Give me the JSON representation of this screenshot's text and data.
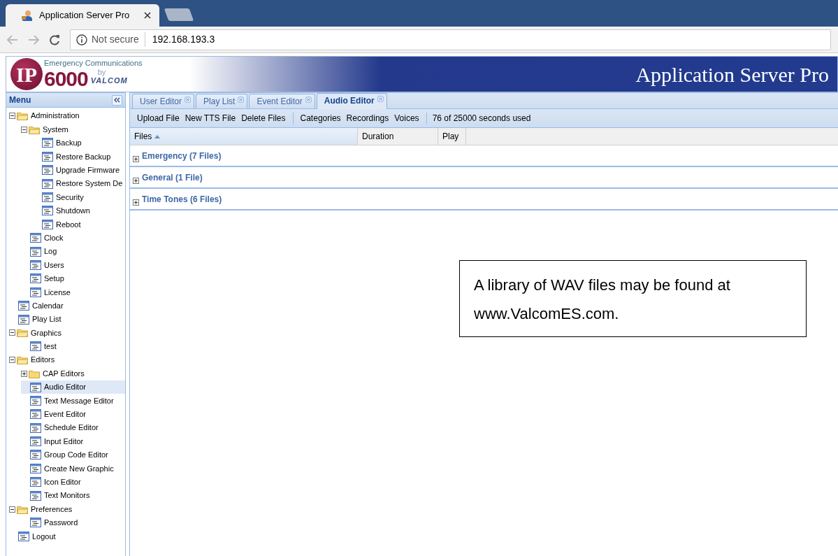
{
  "browser": {
    "tab_title": "Application Server Pro",
    "security": "Not secure",
    "url": "192.168.193.3"
  },
  "header": {
    "logo_letters": "IP",
    "logo_number": "6000",
    "logo_tagline": "Emergency Communications",
    "logo_by": "by",
    "logo_brand": "VALCOM",
    "title": "Application Server Pro"
  },
  "menu": {
    "title": "Menu",
    "tree": [
      {
        "label": "Administration",
        "kind": "folder",
        "expanded": true,
        "selected": false,
        "children": [
          {
            "label": "System",
            "kind": "folder",
            "expanded": true,
            "selected": false,
            "children": [
              {
                "label": "Backup",
                "kind": "page",
                "selected": false
              },
              {
                "label": "Restore Backup",
                "kind": "page",
                "selected": false
              },
              {
                "label": "Upgrade Firmware",
                "kind": "page",
                "selected": false
              },
              {
                "label": "Restore System De",
                "kind": "page",
                "selected": false
              },
              {
                "label": "Security",
                "kind": "page",
                "selected": false
              },
              {
                "label": "Shutdown",
                "kind": "page",
                "selected": false
              },
              {
                "label": "Reboot",
                "kind": "page",
                "selected": false
              }
            ]
          },
          {
            "label": "Clock",
            "kind": "page",
            "selected": false
          },
          {
            "label": "Log",
            "kind": "page",
            "selected": false
          },
          {
            "label": "Users",
            "kind": "page",
            "selected": false
          },
          {
            "label": "Setup",
            "kind": "page",
            "selected": false
          },
          {
            "label": "License",
            "kind": "page",
            "selected": false
          }
        ]
      },
      {
        "label": "Calendar",
        "kind": "page",
        "selected": false
      },
      {
        "label": "Play List",
        "kind": "page",
        "selected": false
      },
      {
        "label": "Graphics",
        "kind": "folder",
        "expanded": true,
        "selected": false,
        "children": [
          {
            "label": "test",
            "kind": "page",
            "selected": false
          }
        ]
      },
      {
        "label": "Editors",
        "kind": "folder",
        "expanded": true,
        "selected": false,
        "children": [
          {
            "label": "CAP Editors",
            "kind": "folder",
            "expanded": false,
            "selected": false
          },
          {
            "label": "Audio Editor",
            "kind": "page",
            "selected": true
          },
          {
            "label": "Text Message Editor",
            "kind": "page",
            "selected": false
          },
          {
            "label": "Event Editor",
            "kind": "page",
            "selected": false
          },
          {
            "label": "Schedule Editor",
            "kind": "page",
            "selected": false
          },
          {
            "label": "Input Editor",
            "kind": "page",
            "selected": false
          },
          {
            "label": "Group Code Editor",
            "kind": "page",
            "selected": false
          },
          {
            "label": "Create New Graphic",
            "kind": "page",
            "selected": false
          },
          {
            "label": "Icon Editor",
            "kind": "page",
            "selected": false
          },
          {
            "label": "Text Monitors",
            "kind": "page",
            "selected": false
          }
        ]
      },
      {
        "label": "Preferences",
        "kind": "folder",
        "expanded": true,
        "selected": false,
        "children": [
          {
            "label": "Password",
            "kind": "page",
            "selected": false
          }
        ]
      },
      {
        "label": "Logout",
        "kind": "page",
        "selected": false
      }
    ]
  },
  "tabs": [
    {
      "label": "User Editor",
      "selected": false
    },
    {
      "label": "Play List",
      "selected": false
    },
    {
      "label": "Event Editor",
      "selected": false
    },
    {
      "label": "Audio Editor",
      "selected": true
    }
  ],
  "toolbar": {
    "groups": [
      [
        "Upload File",
        "New TTS File",
        "Delete Files"
      ],
      [
        "Categories",
        "Recordings",
        "Voices"
      ]
    ],
    "usage": "76 of 25000 seconds used"
  },
  "columns": [
    {
      "label": "Files",
      "sorted": true
    },
    {
      "label": "Duration",
      "sorted": false
    },
    {
      "label": "Play",
      "sorted": false
    }
  ],
  "file_groups": [
    {
      "label": "Emergency (7 Files)",
      "expanded": false
    },
    {
      "label": "General (1 File)",
      "expanded": false
    },
    {
      "label": "Time Tones (6 Files)",
      "expanded": false
    }
  ],
  "note": "A library of WAV files may be found at www.ValcomES.com."
}
